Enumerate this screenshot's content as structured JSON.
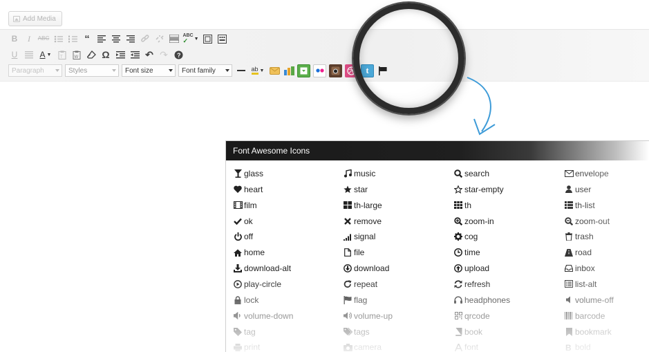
{
  "editor": {
    "add_media_label": "Add Media",
    "format_select": "Paragraph",
    "styles_select": "Styles",
    "font_size_select": "Font size",
    "font_family_select": "Font family"
  },
  "panel": {
    "title": "Font Awesome Icons",
    "columns": [
      [
        {
          "label": "glass",
          "icon": "glass-icon"
        },
        {
          "label": "heart",
          "icon": "heart-icon"
        },
        {
          "label": "film",
          "icon": "film-icon"
        },
        {
          "label": "ok",
          "icon": "check-icon"
        },
        {
          "label": "off",
          "icon": "power-icon"
        },
        {
          "label": "home",
          "icon": "home-icon"
        },
        {
          "label": "download-alt",
          "icon": "download-alt-icon"
        },
        {
          "label": "play-circle",
          "icon": "play-circle-icon"
        },
        {
          "label": "lock",
          "icon": "lock-icon"
        },
        {
          "label": "volume-down",
          "icon": "volume-down-icon"
        },
        {
          "label": "tag",
          "icon": "tag-icon"
        },
        {
          "label": "print",
          "icon": "print-icon"
        }
      ],
      [
        {
          "label": "music",
          "icon": "music-icon"
        },
        {
          "label": "star",
          "icon": "star-icon"
        },
        {
          "label": "th-large",
          "icon": "th-large-icon"
        },
        {
          "label": "remove",
          "icon": "remove-icon"
        },
        {
          "label": "signal",
          "icon": "signal-icon"
        },
        {
          "label": "file",
          "icon": "file-icon"
        },
        {
          "label": "download",
          "icon": "download-icon"
        },
        {
          "label": "repeat",
          "icon": "repeat-icon"
        },
        {
          "label": "flag",
          "icon": "flag-icon"
        },
        {
          "label": "volume-up",
          "icon": "volume-up-icon"
        },
        {
          "label": "tags",
          "icon": "tags-icon"
        },
        {
          "label": "camera",
          "icon": "camera-icon"
        }
      ],
      [
        {
          "label": "search",
          "icon": "search-icon"
        },
        {
          "label": "star-empty",
          "icon": "star-empty-icon"
        },
        {
          "label": "th",
          "icon": "th-icon"
        },
        {
          "label": "zoom-in",
          "icon": "zoom-in-icon"
        },
        {
          "label": "cog",
          "icon": "cog-icon"
        },
        {
          "label": "time",
          "icon": "time-icon"
        },
        {
          "label": "upload",
          "icon": "upload-icon"
        },
        {
          "label": "refresh",
          "icon": "refresh-icon"
        },
        {
          "label": "headphones",
          "icon": "headphones-icon"
        },
        {
          "label": "qrcode",
          "icon": "qrcode-icon"
        },
        {
          "label": "book",
          "icon": "book-icon"
        },
        {
          "label": "font",
          "icon": "font-icon"
        }
      ],
      [
        {
          "label": "envelope",
          "icon": "envelope-icon"
        },
        {
          "label": "user",
          "icon": "user-icon"
        },
        {
          "label": "th-list",
          "icon": "th-list-icon"
        },
        {
          "label": "zoom-out",
          "icon": "zoom-out-icon"
        },
        {
          "label": "trash",
          "icon": "trash-icon"
        },
        {
          "label": "road",
          "icon": "road-icon"
        },
        {
          "label": "inbox",
          "icon": "inbox-icon"
        },
        {
          "label": "list-alt",
          "icon": "list-alt-icon"
        },
        {
          "label": "volume-off",
          "icon": "volume-off-icon"
        },
        {
          "label": "barcode",
          "icon": "barcode-icon"
        },
        {
          "label": "bookmark",
          "icon": "bookmark-icon"
        },
        {
          "label": "bold",
          "icon": "bold-icon"
        }
      ]
    ]
  },
  "colors": {
    "panel_header_bg": "#1a1a1a",
    "arrow": "#3d9bd8",
    "magnifier_ring": "#2c2c2c"
  }
}
